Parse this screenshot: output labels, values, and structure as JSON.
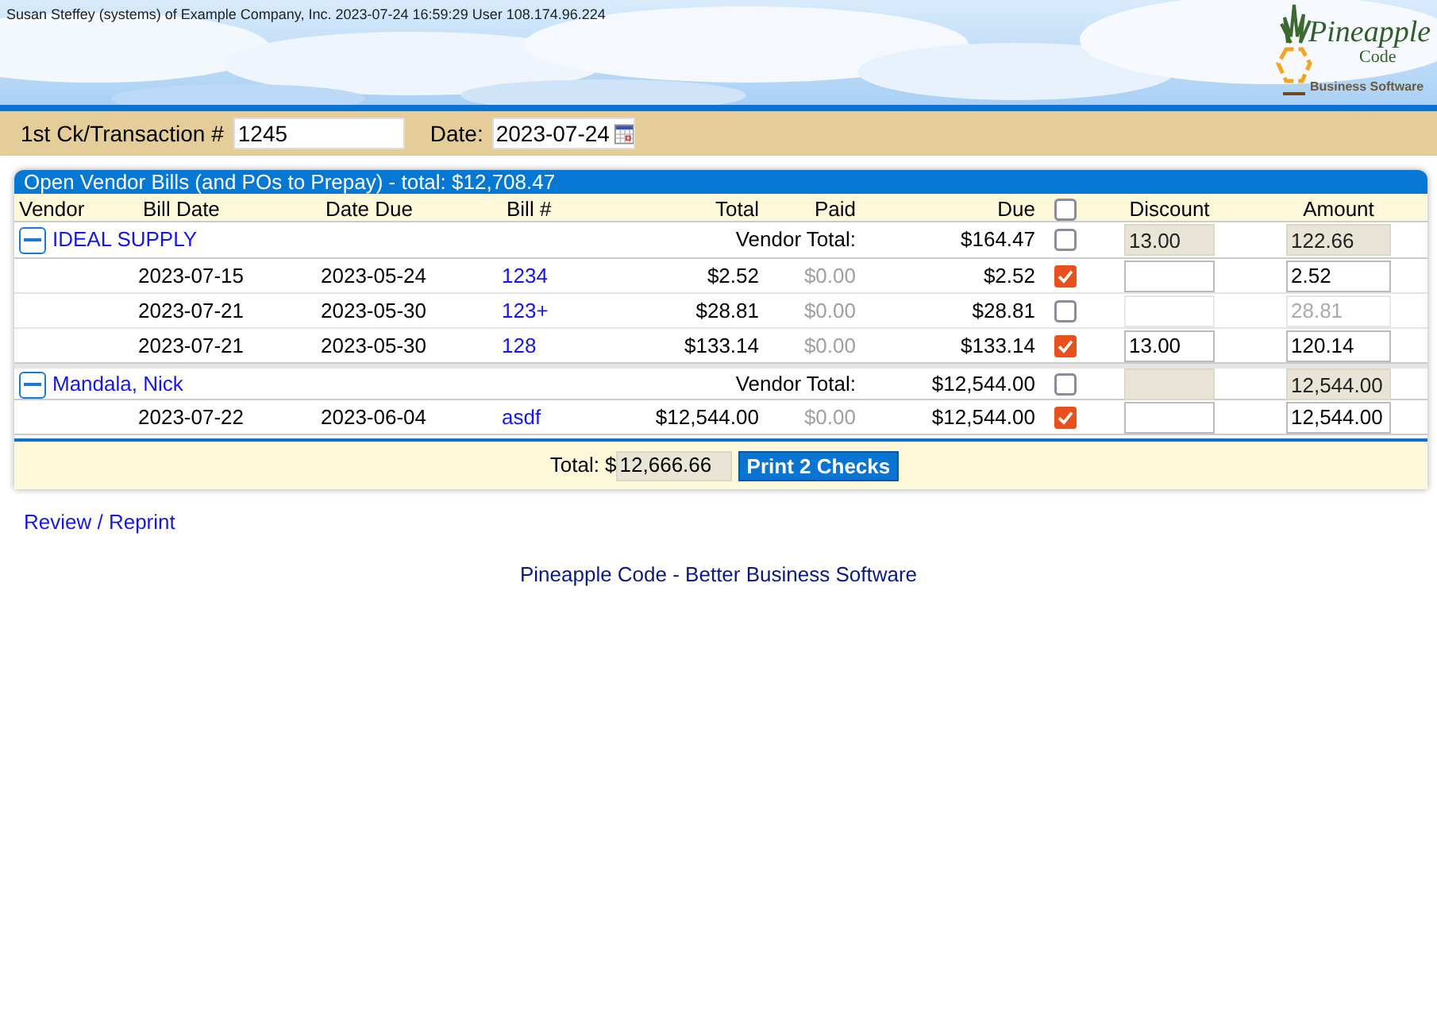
{
  "header": {
    "user_line": "Susan Steffey (systems) of Example Company, Inc. 2023-07-24 16:59:29 User 108.174.96.224",
    "logo": {
      "name": "Pineapple",
      "sub": "Code",
      "tagline": "Business Software"
    }
  },
  "form": {
    "transaction_label": "1st Ck/Transaction #",
    "transaction_value": "1245",
    "date_label": "Date:",
    "date_value": "2023-07-24"
  },
  "panel": {
    "title": "Open Vendor Bills (and POs to Prepay) - total: $12,708.47",
    "columns": [
      {
        "kind": "text",
        "label": "Vendor"
      },
      {
        "kind": "text",
        "label": "Bill Date"
      },
      {
        "kind": "text",
        "label": "Date Due"
      },
      {
        "kind": "text",
        "label": "Bill #"
      },
      {
        "kind": "text",
        "label": "Total"
      },
      {
        "kind": "text",
        "label": "Paid"
      },
      {
        "kind": "text",
        "label": "Due"
      },
      {
        "kind": "checkbox",
        "checked": false
      },
      {
        "kind": "text",
        "label": "Discount"
      },
      {
        "kind": "text",
        "label": "Amount"
      }
    ],
    "vendors": [
      {
        "name": "IDEAL SUPPLY",
        "expanded": true,
        "total_label": "Vendor Total:",
        "due": "$164.47",
        "checked": false,
        "discount": "13.00",
        "amount": "122.66",
        "bills": [
          {
            "bill_date": "2023-07-15",
            "date_due": "2023-05-24",
            "bill_no": "1234",
            "total": "$2.52",
            "paid": "$0.00",
            "due": "$2.52",
            "checked": true,
            "amount": "2.52"
          },
          {
            "bill_date": "2023-07-21",
            "date_due": "2023-05-30",
            "bill_no": "123+",
            "total": "$28.81",
            "paid": "$0.00",
            "due": "$28.81",
            "checked": false,
            "amount": "28.81"
          },
          {
            "bill_date": "2023-07-21",
            "date_due": "2023-05-30",
            "bill_no": "128",
            "total": "$133.14",
            "paid": "$0.00",
            "due": "$133.14",
            "checked": true,
            "discount": "13.00",
            "amount": "120.14"
          }
        ]
      },
      {
        "name": "Mandala, Nick",
        "expanded": true,
        "total_label": "Vendor Total:",
        "due": "$12,544.00",
        "checked": false,
        "amount": "12,544.00",
        "bills": [
          {
            "bill_date": "2023-07-22",
            "date_due": "2023-06-04",
            "bill_no": "asdf",
            "total": "$12,544.00",
            "paid": "$0.00",
            "due": "$12,544.00",
            "checked": true,
            "amount": "12,544.00"
          }
        ]
      }
    ],
    "footer": {
      "total_label": "Total: $",
      "total_value": "12,666.66",
      "button": "Print 2 Checks"
    }
  },
  "review_link": "Review / Reprint",
  "footer_text": "Pineapple Code - Better Business Software"
}
